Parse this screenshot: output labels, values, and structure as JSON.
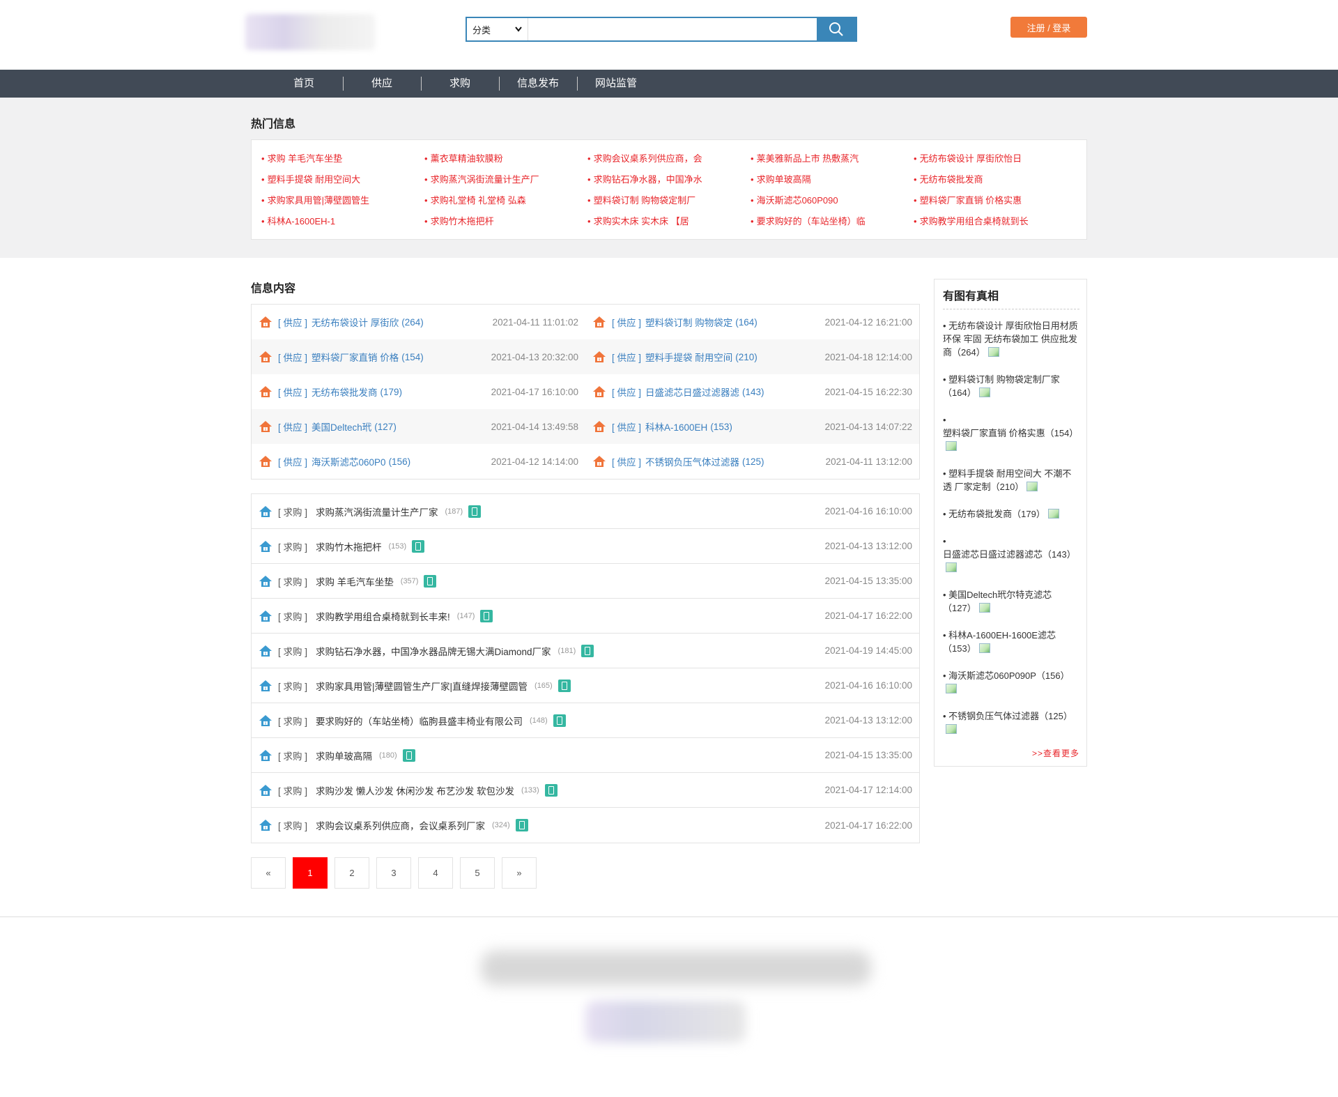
{
  "header": {
    "search_select": "分类",
    "search_placeholder": "",
    "login_label": "注册 / 登录"
  },
  "nav": [
    "首页",
    "供应",
    "求购",
    "信息发布",
    "网站监管"
  ],
  "hot": {
    "title": "热门信息",
    "items": [
      "求购 羊毛汽车坐垫",
      "薰衣草精油软膜粉",
      "求购会议桌系列供应商，会",
      "莱美雅新品上市 热敷蒸汽",
      "无纺布袋设计 厚街欣怡日",
      "塑料手提袋 耐用空间大",
      "求购蒸汽涡街流量计生产厂",
      "求购钻石净水器，中国净水",
      "求购单玻高隔",
      "无纺布袋批发商",
      "求购家具用管|薄壁圆管生",
      "求购礼堂椅 礼堂椅 弘森",
      "塑料袋订制 购物袋定制厂",
      "海沃斯滤芯060P090",
      "塑料袋厂家直销 价格实惠",
      "科林A-1600EH-1",
      "求购竹木拖把杆",
      "求购实木床 实木床 【居",
      "要求购好的（车站坐椅）临",
      "求购教学用组合桌椅就到长"
    ]
  },
  "content": {
    "title": "信息内容",
    "supply": [
      [
        {
          "cat": "[ 供应 ]",
          "title": "无纺布袋设计 厚街欣",
          "count": "(264)",
          "date": "2021-04-11 11:01:02"
        },
        {
          "cat": "[ 供应 ]",
          "title": "塑料袋订制 购物袋定",
          "count": "(164)",
          "date": "2021-04-12 16:21:00"
        }
      ],
      [
        {
          "cat": "[ 供应 ]",
          "title": "塑料袋厂家直销 价格",
          "count": "(154)",
          "date": "2021-04-13 20:32:00"
        },
        {
          "cat": "[ 供应 ]",
          "title": "塑料手提袋 耐用空间",
          "count": "(210)",
          "date": "2021-04-18 12:14:00"
        }
      ],
      [
        {
          "cat": "[ 供应 ]",
          "title": "无纺布袋批发商",
          "count": "(179)",
          "date": "2021-04-17 16:10:00"
        },
        {
          "cat": "[ 供应 ]",
          "title": "日盛滤芯日盛过滤器滤",
          "count": "(143)",
          "date": "2021-04-15 16:22:30"
        }
      ],
      [
        {
          "cat": "[ 供应 ]",
          "title": "美国Deltech玳",
          "count": "(127)",
          "date": "2021-04-14 13:49:58"
        },
        {
          "cat": "[ 供应 ]",
          "title": "科林A-1600EH",
          "count": "(153)",
          "date": "2021-04-13 14:07:22"
        }
      ],
      [
        {
          "cat": "[ 供应 ]",
          "title": "海沃斯滤芯060P0",
          "count": "(156)",
          "date": "2021-04-12 14:14:00"
        },
        {
          "cat": "[ 供应 ]",
          "title": "不锈钢负压气体过滤器",
          "count": "(125)",
          "date": "2021-04-11 13:12:00"
        }
      ]
    ],
    "buy": [
      {
        "cat": "[ 求购 ]",
        "title": "求购蒸汽涡街流量计生产厂家",
        "count": "(187)",
        "date": "2021-04-16 16:10:00"
      },
      {
        "cat": "[ 求购 ]",
        "title": "求购竹木拖把杆",
        "count": "(153)",
        "date": "2021-04-13 13:12:00"
      },
      {
        "cat": "[ 求购 ]",
        "title": "求购 羊毛汽车坐垫",
        "count": "(357)",
        "date": "2021-04-15 13:35:00"
      },
      {
        "cat": "[ 求购 ]",
        "title": "求购教学用组合桌椅就到长丰来!",
        "count": "(147)",
        "date": "2021-04-17 16:22:00"
      },
      {
        "cat": "[ 求购 ]",
        "title": "求购钻石净水器，中国净水器品牌无锡大满Diamond厂家",
        "count": "(181)",
        "date": "2021-04-19 14:45:00"
      },
      {
        "cat": "[ 求购 ]",
        "title": "求购家具用管|薄壁圆管生产厂家|直缝焊接薄壁圆管",
        "count": "(165)",
        "date": "2021-04-16 16:10:00"
      },
      {
        "cat": "[ 求购 ]",
        "title": "要求购好的（车站坐椅）临朐县盛丰椅业有限公司",
        "count": "(148)",
        "date": "2021-04-13 13:12:00"
      },
      {
        "cat": "[ 求购 ]",
        "title": "求购单玻高隔",
        "count": "(180)",
        "date": "2021-04-15 13:35:00"
      },
      {
        "cat": "[ 求购 ]",
        "title": "求购沙发 懒人沙发 休闲沙发 布艺沙发 软包沙发",
        "count": "(133)",
        "date": "2021-04-17 12:14:00"
      },
      {
        "cat": "[ 求购 ]",
        "title": "求购会议桌系列供应商，会议桌系列厂家",
        "count": "(324)",
        "date": "2021-04-17 16:22:00"
      }
    ],
    "pager": [
      "«",
      "1",
      "2",
      "3",
      "4",
      "5",
      "»"
    ],
    "active_page": "1"
  },
  "sidebar": {
    "title": "有图有真相",
    "items": [
      "无纺布袋设计 厚街欣怡日用材质环保 牢固 无纺布袋加工 供应批发商（264）",
      "塑料袋订制 购物袋定制厂家（164）",
      "塑料袋厂家直销 价格实惠（154）",
      "塑料手提袋 耐用空间大 不潮不透 厂家定制（210）",
      "无纺布袋批发商（179）",
      "日盛滤芯日盛过滤器滤芯（143）",
      "美国Deltech玳尔特克滤芯（127）",
      "科林A-1600EH-1600E滤芯（153）",
      "海沃斯滤芯060P090P（156）",
      "不锈钢负压气体过滤器（125）"
    ],
    "more": ">>查看更多"
  },
  "colors": {
    "accent_blue": "#3a86b8",
    "nav_bg": "#414a56",
    "login_orange": "#f17a3a",
    "hot_red": "#e8262b",
    "supply_blue": "#3a7fbf",
    "active_page": "#ff0000"
  }
}
